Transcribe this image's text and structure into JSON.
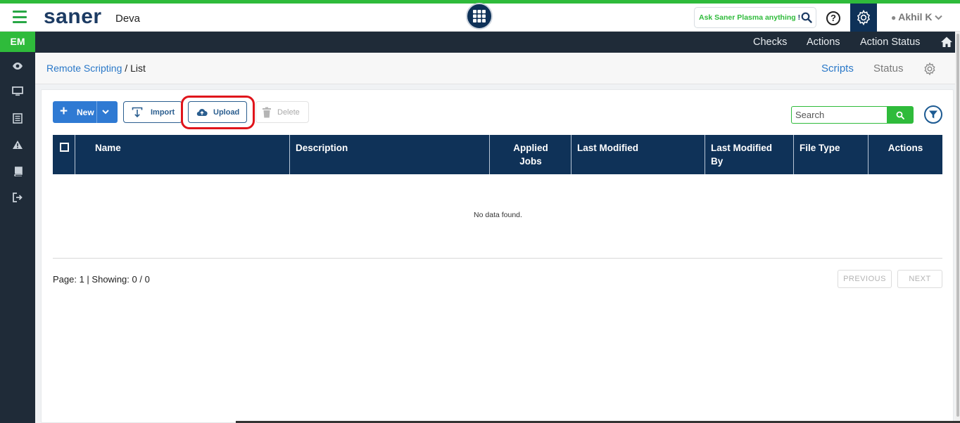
{
  "header": {
    "brand": "saner",
    "tenant": "Deva",
    "ask": {
      "text": "Ask Saner Plasma anything",
      "ai_mark": "!"
    },
    "help_label": "?",
    "user": "Akhil K"
  },
  "sidebar": {
    "badge": "EM",
    "icons": [
      "eye-icon",
      "monitor-icon",
      "list-icon",
      "warning-icon",
      "book-icon",
      "logout-icon"
    ]
  },
  "subnav": {
    "items": [
      "Checks",
      "Actions",
      "Action Status"
    ]
  },
  "breadcrumb": {
    "parent": "Remote Scripting",
    "separator": "/",
    "current": "List"
  },
  "tabs": {
    "scripts": "Scripts",
    "status": "Status"
  },
  "toolbar": {
    "new_label": "New",
    "import_label": "Import",
    "upload_label": "Upload",
    "delete_label": "Delete",
    "search_placeholder": "Search"
  },
  "table": {
    "columns": [
      "Name",
      "Description",
      "Applied Jobs",
      "Last Modified",
      "Last Modified By",
      "File Type",
      "Actions"
    ],
    "empty_message": "No data found."
  },
  "pagination": {
    "summary": "Page: 1 | Showing: 0 / 0",
    "previous": "PREVIOUS",
    "next": "NEXT"
  },
  "colors": {
    "brand_navy": "#0f3258",
    "accent_green": "#2fbb3b",
    "primary_blue": "#2f7ad3",
    "highlight_red": "#e0141b"
  }
}
